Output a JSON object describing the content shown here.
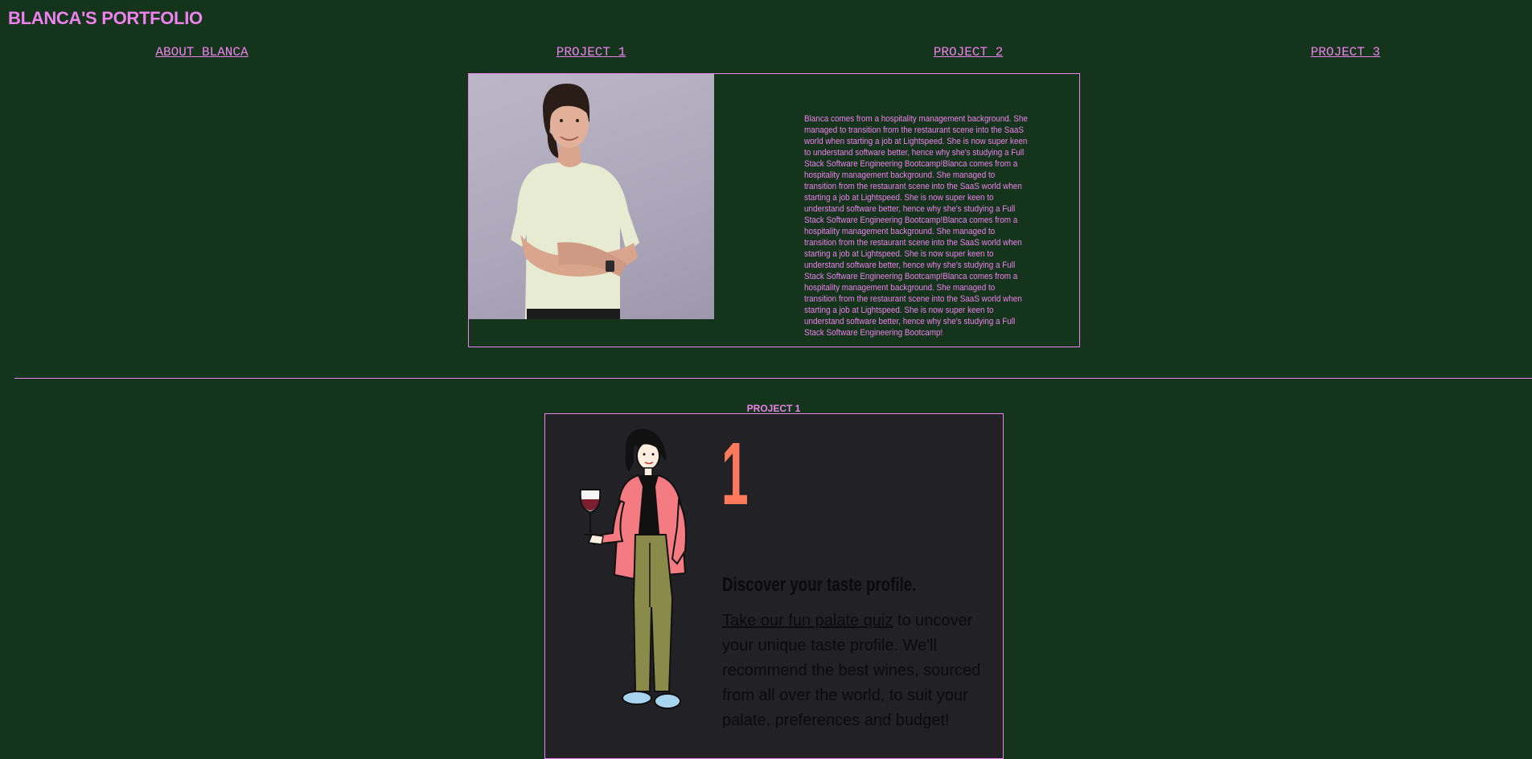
{
  "header": {
    "title": "BLANCA'S PORTFOLIO"
  },
  "nav": {
    "items": [
      {
        "label": "ABOUT BLANCA"
      },
      {
        "label": "PROJECT 1"
      },
      {
        "label": "PROJECT 2"
      },
      {
        "label": "PROJECT 3"
      }
    ]
  },
  "about": {
    "paragraph": "Blanca comes from a hospitality management background. She managed to transition from the restaurant scene into the SaaS world when starting a job at Lightspeed. She is now super keen to understand software better, hence why she's studying a Full Stack Software Engineering Bootcamp!Blanca comes from a hospitality management background. She managed to transition from the restaurant scene into the SaaS world when starting a job at Lightspeed. She is now super keen to understand software better, hence why she's studying a Full Stack Software Engineering Bootcamp!Blanca comes from a hospitality management background. She managed to transition from the restaurant scene into the SaaS world when starting a job at Lightspeed. She is now super keen to understand software better, hence why she's studying a Full Stack Software Engineering Bootcamp!Blanca comes from a hospitality management background. She managed to transition from the restaurant scene into the SaaS world when starting a job at Lightspeed. She is now super keen to understand software better, hence why she's studying a Full Stack Software Engineering Bootcamp!"
  },
  "project1": {
    "heading": "PROJECT 1",
    "step_number": "1",
    "title": "Discover your taste profile.",
    "link_text": "Take our fun palate quiz",
    "body_text": " to uncover your unique taste profile. We'll recommend the best wines, sourced from all over the world, to suit your palate, preferences and budget!"
  },
  "colors": {
    "background": "#14341b",
    "accent": "#ee82ee",
    "card_background": "#222226",
    "number": "#ff7a5c"
  }
}
